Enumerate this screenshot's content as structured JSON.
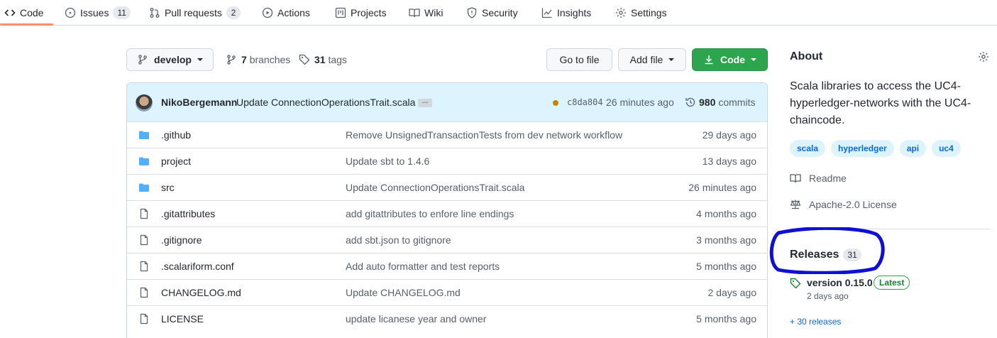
{
  "nav": {
    "code": "Code",
    "issues": "Issues",
    "issues_count": "11",
    "pulls": "Pull requests",
    "pulls_count": "2",
    "actions": "Actions",
    "projects": "Projects",
    "wiki": "Wiki",
    "security": "Security",
    "insights": "Insights",
    "settings": "Settings"
  },
  "toolbar": {
    "branch": "develop",
    "branches_count": "7",
    "branches_label": "branches",
    "tags_count": "31",
    "tags_label": "tags",
    "go_to_file": "Go to file",
    "add_file": "Add file",
    "code": "Code"
  },
  "commit": {
    "author": "NikoBergemann",
    "message": "Update ConnectionOperationsTrait.scala",
    "ellipsis": "...",
    "sha": "c8da804",
    "time": "26 minutes ago",
    "commits_count": "980",
    "commits_label": "commits"
  },
  "files": [
    {
      "name": ".github",
      "type": "folder",
      "message": "Remove UnsignedTransactionTests from dev network workflow",
      "age": "29 days ago"
    },
    {
      "name": "project",
      "type": "folder",
      "message": "Update sbt to 1.4.6",
      "age": "13 days ago"
    },
    {
      "name": "src",
      "type": "folder",
      "message": "Update ConnectionOperationsTrait.scala",
      "age": "26 minutes ago"
    },
    {
      "name": ".gitattributes",
      "type": "file",
      "message": "add gitattributes to enfore line endings",
      "age": "4 months ago"
    },
    {
      "name": ".gitignore",
      "type": "file",
      "message": "add sbt.json to gitignore",
      "age": "3 months ago"
    },
    {
      "name": ".scalariform.conf",
      "type": "file",
      "message": "Add auto formatter and test reports",
      "age": "5 months ago"
    },
    {
      "name": "CHANGELOG.md",
      "type": "file",
      "message": "Update CHANGELOG.md",
      "age": "2 days ago"
    },
    {
      "name": "LICENSE",
      "type": "file",
      "message": "update licanese year and owner",
      "age": "5 months ago"
    }
  ],
  "about": {
    "title": "About",
    "description": "Scala libraries to access the UC4-hyperledger-networks with the UC4-chaincode.",
    "topics": [
      "scala",
      "hyperledger",
      "api",
      "uc4"
    ],
    "readme": "Readme",
    "license": "Apache-2.0 License"
  },
  "releases": {
    "title": "Releases",
    "count": "31",
    "latest_name": "version 0.15.0",
    "latest_badge": "Latest",
    "latest_date": "2 days ago",
    "more": "+ 30 releases"
  },
  "colors": {
    "accent_underline": "#fd8c73",
    "green_button": "#2da44e",
    "folder_icon": "#54aeff",
    "link": "#0969da",
    "annotation_circle": "#1010d0"
  }
}
